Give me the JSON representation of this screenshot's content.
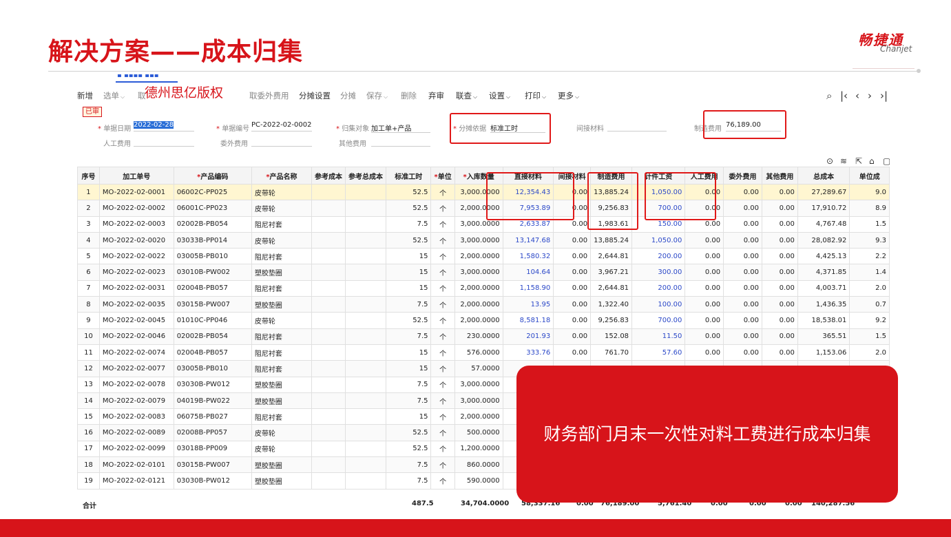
{
  "slide": {
    "title": "解决方案——成本归集",
    "logo_cn": "畅捷通",
    "logo_en": "Chanjet",
    "callout": "财务部门月末一次性对料工费进行成本归集",
    "watermark": "德州思亿版权",
    "brand_color": "#d7141a"
  },
  "toolbar": {
    "items": [
      {
        "label": "新增",
        "caret": false,
        "dim": false
      },
      {
        "label": "选单",
        "caret": true,
        "dim": true
      },
      {
        "label": "取",
        "caret": false,
        "dim": true
      },
      {
        "label": "",
        "caret": true,
        "dim": true
      },
      {
        "label": "取委外费用",
        "caret": false,
        "dim": true
      },
      {
        "label": "分摊设置",
        "caret": false,
        "dim": false
      },
      {
        "label": "分摊",
        "caret": false,
        "dim": true
      },
      {
        "label": "保存",
        "caret": true,
        "dim": true
      },
      {
        "label": "删除",
        "caret": false,
        "dim": true
      },
      {
        "label": "弃审",
        "caret": false,
        "dim": false
      },
      {
        "label": "联查",
        "caret": true,
        "dim": false
      },
      {
        "label": "设置",
        "caret": true,
        "dim": false
      },
      {
        "label": "打印",
        "caret": true,
        "dim": false
      },
      {
        "label": "更多",
        "caret": true,
        "dim": false
      }
    ],
    "nav_icons": [
      "search-doc-icon",
      "first-page-icon",
      "prev-icon",
      "next-icon",
      "last-page-icon"
    ]
  },
  "form": {
    "status": "已审",
    "date_label": "单据日期",
    "date_value": "2022-02-28",
    "code_label": "单据编号",
    "code_value": "PC-2022-02-0002",
    "object_label": "归集对象",
    "object_value": "加工单+产品",
    "basis_label": "分摊依据",
    "basis_value": "标准工时",
    "indirect_material_label": "间接材料",
    "mfg_cost_label": "制造费用",
    "mfg_cost_value": "76,189.00",
    "labor_label": "人工费用",
    "outsource_label": "委外费用",
    "other_label": "其他费用"
  },
  "table": {
    "columns": [
      {
        "label": "序号",
        "req": false
      },
      {
        "label": "加工单号",
        "req": false
      },
      {
        "label": "产品编码",
        "req": true
      },
      {
        "label": "产品名称",
        "req": true
      },
      {
        "label": "参考成本",
        "req": false
      },
      {
        "label": "参考总成本",
        "req": false
      },
      {
        "label": "标准工时",
        "req": false
      },
      {
        "label": "单位",
        "req": true
      },
      {
        "label": "入库数量",
        "req": true
      },
      {
        "label": "直接材料",
        "req": false
      },
      {
        "label": "间接材料",
        "req": false
      },
      {
        "label": "制造费用",
        "req": false
      },
      {
        "label": "计件工资",
        "req": false
      },
      {
        "label": "人工费用",
        "req": false
      },
      {
        "label": "委外费用",
        "req": false
      },
      {
        "label": "其他费用",
        "req": false
      },
      {
        "label": "总成本",
        "req": false
      },
      {
        "label": "单位成",
        "req": false
      }
    ],
    "rows": [
      [
        "1",
        "MO-2022-02-0001",
        "06002C-PP025",
        "皮带轮",
        "",
        "",
        "52.5",
        "个",
        "3,000.0000",
        "12,354.43",
        "0.00",
        "13,885.24",
        "1,050.00",
        "0.00",
        "0.00",
        "0.00",
        "27,289.67",
        "9.0"
      ],
      [
        "2",
        "MO-2022-02-0002",
        "06001C-PP023",
        "皮带轮",
        "",
        "",
        "52.5",
        "个",
        "2,000.0000",
        "7,953.89",
        "0.00",
        "9,256.83",
        "700.00",
        "0.00",
        "0.00",
        "0.00",
        "17,910.72",
        "8.9"
      ],
      [
        "3",
        "MO-2022-02-0003",
        "02002B-PB054",
        "阻尼衬套",
        "",
        "",
        "7.5",
        "个",
        "3,000.0000",
        "2,633.87",
        "0.00",
        "1,983.61",
        "150.00",
        "0.00",
        "0.00",
        "0.00",
        "4,767.48",
        "1.5"
      ],
      [
        "4",
        "MO-2022-02-0020",
        "03033B-PP014",
        "皮带轮",
        "",
        "",
        "52.5",
        "个",
        "3,000.0000",
        "13,147.68",
        "0.00",
        "13,885.24",
        "1,050.00",
        "0.00",
        "0.00",
        "0.00",
        "28,082.92",
        "9.3"
      ],
      [
        "5",
        "MO-2022-02-0022",
        "03005B-PB010",
        "阻尼衬套",
        "",
        "",
        "15",
        "个",
        "2,000.0000",
        "1,580.32",
        "0.00",
        "2,644.81",
        "200.00",
        "0.00",
        "0.00",
        "0.00",
        "4,425.13",
        "2.2"
      ],
      [
        "6",
        "MO-2022-02-0023",
        "03010B-PW002",
        "塑胶垫圈",
        "",
        "",
        "15",
        "个",
        "3,000.0000",
        "104.64",
        "0.00",
        "3,967.21",
        "300.00",
        "0.00",
        "0.00",
        "0.00",
        "4,371.85",
        "1.4"
      ],
      [
        "7",
        "MO-2022-02-0031",
        "02004B-PB057",
        "阻尼衬套",
        "",
        "",
        "15",
        "个",
        "2,000.0000",
        "1,158.90",
        "0.00",
        "2,644.81",
        "200.00",
        "0.00",
        "0.00",
        "0.00",
        "4,003.71",
        "2.0"
      ],
      [
        "8",
        "MO-2022-02-0035",
        "03015B-PW007",
        "塑胶垫圈",
        "",
        "",
        "7.5",
        "个",
        "2,000.0000",
        "13.95",
        "0.00",
        "1,322.40",
        "100.00",
        "0.00",
        "0.00",
        "0.00",
        "1,436.35",
        "0.7"
      ],
      [
        "9",
        "MO-2022-02-0045",
        "01010C-PP046",
        "皮带轮",
        "",
        "",
        "52.5",
        "个",
        "2,000.0000",
        "8,581.18",
        "0.00",
        "9,256.83",
        "700.00",
        "0.00",
        "0.00",
        "0.00",
        "18,538.01",
        "9.2"
      ],
      [
        "10",
        "MO-2022-02-0046",
        "02002B-PB054",
        "阻尼衬套",
        "",
        "",
        "7.5",
        "个",
        "230.0000",
        "201.93",
        "0.00",
        "152.08",
        "11.50",
        "0.00",
        "0.00",
        "0.00",
        "365.51",
        "1.5"
      ],
      [
        "11",
        "MO-2022-02-0074",
        "02004B-PB057",
        "阻尼衬套",
        "",
        "",
        "15",
        "个",
        "576.0000",
        "333.76",
        "0.00",
        "761.70",
        "57.60",
        "0.00",
        "0.00",
        "0.00",
        "1,153.06",
        "2.0"
      ],
      [
        "12",
        "MO-2022-02-0077",
        "03005B-PB010",
        "阻尼衬套",
        "",
        "",
        "15",
        "个",
        "57.0000",
        "",
        "",
        "",
        "",
        "",
        "",
        "",
        "",
        ""
      ],
      [
        "13",
        "MO-2022-02-0078",
        "03030B-PW012",
        "塑胶垫圈",
        "",
        "",
        "7.5",
        "个",
        "3,000.0000",
        "",
        "",
        "",
        "",
        "",
        "",
        "",
        "",
        ""
      ],
      [
        "14",
        "MO-2022-02-0079",
        "04019B-PW022",
        "塑胶垫圈",
        "",
        "",
        "7.5",
        "个",
        "3,000.0000",
        "",
        "",
        "",
        "",
        "",
        "",
        "",
        "",
        ""
      ],
      [
        "15",
        "MO-2022-02-0083",
        "06075B-PB027",
        "阻尼衬套",
        "",
        "",
        "15",
        "个",
        "2,000.0000",
        "",
        "",
        "",
        "",
        "",
        "",
        "",
        "",
        ""
      ],
      [
        "16",
        "MO-2022-02-0089",
        "02008B-PP057",
        "皮带轮",
        "",
        "",
        "52.5",
        "个",
        "500.0000",
        "",
        "",
        "",
        "",
        "",
        "",
        "",
        "",
        ""
      ],
      [
        "17",
        "MO-2022-02-0099",
        "03018B-PP009",
        "皮带轮",
        "",
        "",
        "52.5",
        "个",
        "1,200.0000",
        "",
        "",
        "",
        "",
        "",
        "",
        "",
        "",
        ""
      ],
      [
        "18",
        "MO-2022-02-0101",
        "03015B-PW007",
        "塑胶垫圈",
        "",
        "",
        "7.5",
        "个",
        "860.0000",
        "",
        "",
        "",
        "",
        "",
        "",
        "",
        "",
        ""
      ],
      [
        "19",
        "MO-2022-02-0121",
        "03030B-PW012",
        "塑胶垫圈",
        "",
        "",
        "7.5",
        "个",
        "590.0000",
        "",
        "",
        "",
        "",
        "",
        "",
        "",
        "",
        ""
      ]
    ],
    "totals": {
      "label": "合计",
      "std_hours": "487.5",
      "qty": "34,704.0000",
      "direct_material": "58,337.16",
      "indirect_material": "0.00",
      "mfg_cost": "76,189.00",
      "piece_wage": "5,761.40",
      "labor": "0.00",
      "outsource": "0.00",
      "other": "0.00",
      "total": "140,287.56"
    }
  }
}
